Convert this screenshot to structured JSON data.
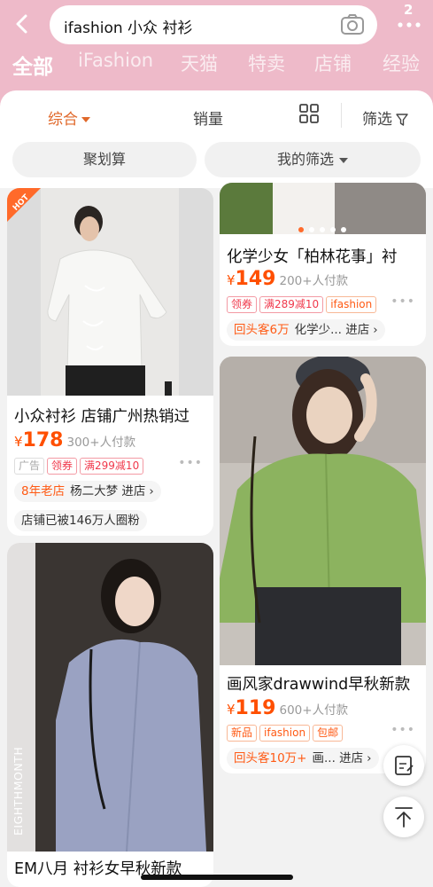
{
  "header": {
    "search_query": "ifashion 小众 衬衫",
    "badge_count": "2",
    "category_tabs": [
      "全部",
      "iFashion",
      "天猫",
      "特卖",
      "店铺",
      "经验"
    ]
  },
  "sort_bar": {
    "default_sort": "综合",
    "sales_sort": "销量",
    "filter": "筛选"
  },
  "chips": {
    "juhuasuan": "聚划算",
    "my_filter": "我的筛选"
  },
  "products": [
    {
      "title": "小众衬衫 店铺广州热销过",
      "currency": "¥",
      "price": "178",
      "sold": "300+人付款",
      "tags": [
        "广告",
        "领券",
        "满299减10"
      ],
      "store_tag": "8年老店",
      "store_name": "杨二大梦",
      "store_link": "进店",
      "fans": "店铺已被146万人圈粉",
      "hot_label": "HOT"
    },
    {
      "title": "化学少女「柏林花事」衬",
      "currency": "¥",
      "price": "149",
      "sold": "200+人付款",
      "tags": [
        "领券",
        "满289减10",
        "ifashion"
      ],
      "store_tag": "回头客6万",
      "store_name": "化学少...",
      "store_link": "进店"
    },
    {
      "title": "画风家drawwind早秋新款",
      "currency": "¥",
      "price": "119",
      "sold": "600+人付款",
      "tags": [
        "新品",
        "ifashion",
        "包邮"
      ],
      "store_tag": "回头客10万+",
      "store_name": "画...",
      "store_link": "进店"
    },
    {
      "title": "EM八月 衬衫女早秋新款",
      "brand_print": "EIGHTHMONTH"
    }
  ],
  "colors": {
    "header_pink": "#eebac9",
    "accent_orange": "#ff4f00",
    "tag_red": "#f0394c"
  },
  "icons": [
    "back-icon",
    "camera-icon",
    "more-icon",
    "grid-view-icon",
    "filter-icon",
    "edit-icon",
    "back-to-top-icon"
  ]
}
